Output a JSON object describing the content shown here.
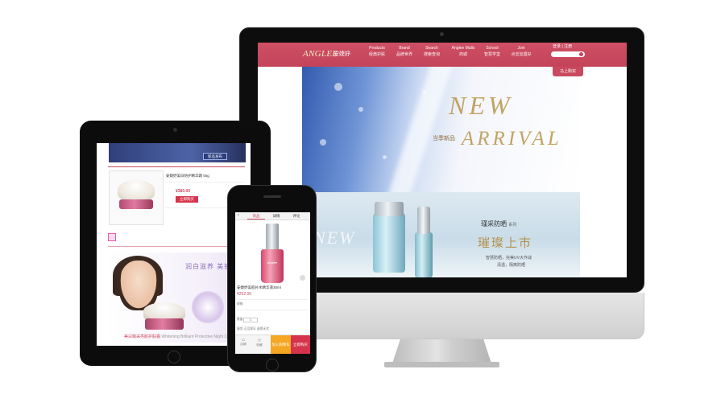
{
  "desktop": {
    "brand": {
      "logo": "ANGLEE",
      "name_cn": "安婕妤"
    },
    "nav": [
      {
        "en": "Products",
        "cn": "经典护肤"
      },
      {
        "en": "Brand",
        "cn": "品牌世界"
      },
      {
        "en": "Search",
        "cn": "搜索查询"
      },
      {
        "en": "Anglee Malls",
        "cn": "商城"
      },
      {
        "en": "School",
        "cn": "智慧学堂"
      },
      {
        "en": "Join",
        "cn": "点击加盟好"
      }
    ],
    "login": "登录 | 注册",
    "cta": "马上购买",
    "hero": {
      "line1": "NEW",
      "line2": "ARRIVAL",
      "caption": "当季新品"
    },
    "banner2": {
      "watermark": "NEW",
      "series": "瑾采防晒",
      "series_suffix": "系列",
      "headline": "璀璨上市",
      "desc1": "智慧防晒，完美UV大作战",
      "desc2": "清透，隔离防晒"
    }
  },
  "tablet": {
    "banner_button": "新品发布",
    "product_name": "安婕妤美白防护精华霜 50g",
    "price": "¥380.00",
    "buy_button": "立即购买",
    "promo_slogan": "润白滋养 美拍嫩白",
    "promo_caption": "美白臻采亮颜护肤霜",
    "promo_caption_en": "Whitening Brilliant Protective Night Cream"
  },
  "phone": {
    "tabs": [
      "商品",
      "详情",
      "评论"
    ],
    "product_name": "安婕妤美肌补水精华液30ml",
    "price": "¥252.00",
    "row_spec": "规格",
    "row_qty": "数量",
    "qty": "1",
    "row_service": "服务 正品保证 退换无忧",
    "bottom": {
      "store": "店铺",
      "favorite": "收藏",
      "cart": "加入购物车",
      "buy": "立即购买"
    }
  }
}
